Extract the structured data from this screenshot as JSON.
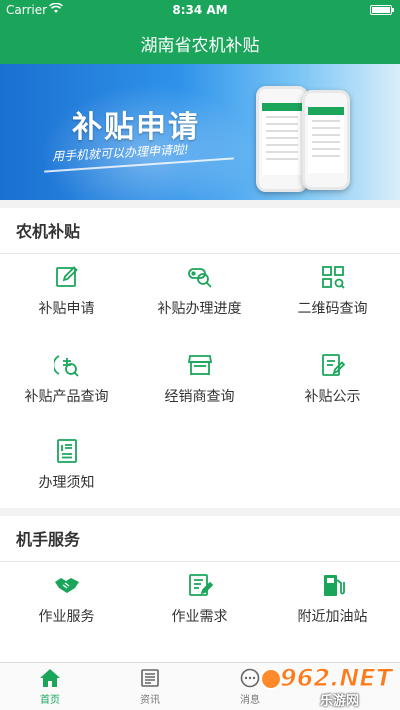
{
  "status_bar": {
    "carrier": "Carrier",
    "time": "8:34 AM"
  },
  "nav": {
    "title": "湖南省农机补贴"
  },
  "banner": {
    "headline": "补贴申请",
    "tagline": "用手机就可以办理申请啦!"
  },
  "sections": [
    {
      "title": "农机补贴",
      "items": [
        {
          "label": "补贴申请",
          "icon": "edit-icon"
        },
        {
          "label": "补贴办理进度",
          "icon": "progress-search-icon"
        },
        {
          "label": "二维码查询",
          "icon": "qr-grid-icon"
        },
        {
          "label": "补贴产品查询",
          "icon": "product-search-icon"
        },
        {
          "label": "经销商查询",
          "icon": "store-icon"
        },
        {
          "label": "补贴公示",
          "icon": "notice-edit-icon"
        },
        {
          "label": "办理须知",
          "icon": "document-icon"
        }
      ]
    },
    {
      "title": "机手服务",
      "items": [
        {
          "label": "作业服务",
          "icon": "handshake-icon"
        },
        {
          "label": "作业需求",
          "icon": "request-form-icon"
        },
        {
          "label": "附近加油站",
          "icon": "fuel-station-icon"
        }
      ]
    }
  ],
  "tabs": [
    {
      "label": "首页",
      "icon": "home-icon",
      "active": true
    },
    {
      "label": "资讯",
      "icon": "news-icon",
      "active": false
    },
    {
      "label": "消息",
      "icon": "message-icon",
      "active": false
    }
  ],
  "watermark": {
    "brand": "962.NET",
    "site": "乐游网"
  },
  "colors": {
    "primary": "#1aa55a",
    "banner_blue": "#2f93ea",
    "watermark_orange": "#ff7a1a"
  }
}
